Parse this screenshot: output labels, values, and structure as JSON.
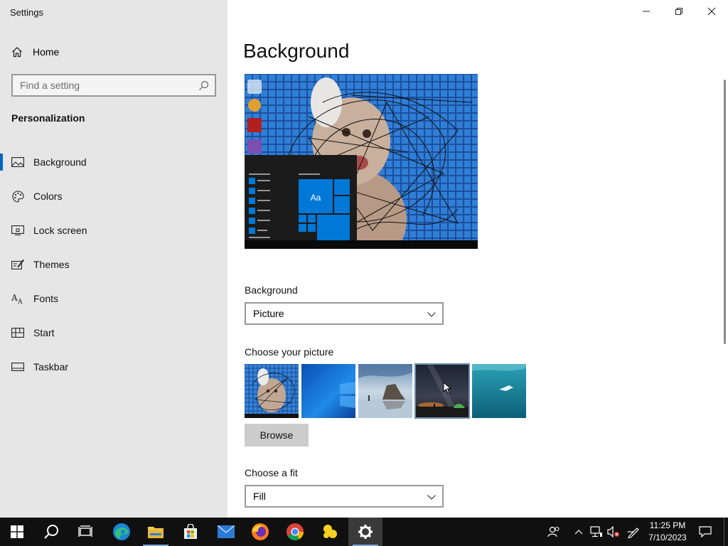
{
  "window": {
    "title": "Settings"
  },
  "sidebar": {
    "home_label": "Home",
    "search_placeholder": "Find a setting",
    "section_title": "Personalization",
    "items": [
      {
        "label": "Background",
        "icon": "picture-icon",
        "active": true
      },
      {
        "label": "Colors",
        "icon": "palette-icon"
      },
      {
        "label": "Lock screen",
        "icon": "lock-screen-icon"
      },
      {
        "label": "Themes",
        "icon": "themes-icon"
      },
      {
        "label": "Fonts",
        "icon": "fonts-icon"
      },
      {
        "label": "Start",
        "icon": "start-icon"
      },
      {
        "label": "Taskbar",
        "icon": "taskbar-icon"
      }
    ]
  },
  "main": {
    "title": "Background",
    "preview_tile_text": "Aa",
    "background_label": "Background",
    "background_value": "Picture",
    "choose_picture_label": "Choose your picture",
    "browse_label": "Browse",
    "choose_fit_label": "Choose a fit",
    "fit_value": "Fill"
  },
  "taskbar": {
    "apps": [
      "start-icon",
      "search-icon",
      "task-view-icon",
      "edge-icon",
      "file-explorer-icon",
      "store-icon",
      "mail-icon",
      "firefox-icon",
      "chrome-icon",
      "app-icon",
      "settings-icon"
    ],
    "time": "11:25 PM",
    "date": "7/10/2023"
  },
  "colors": {
    "accent": "#0067c0",
    "sidebar_bg": "#e6e6e6",
    "taskbar_bg": "#101010"
  }
}
